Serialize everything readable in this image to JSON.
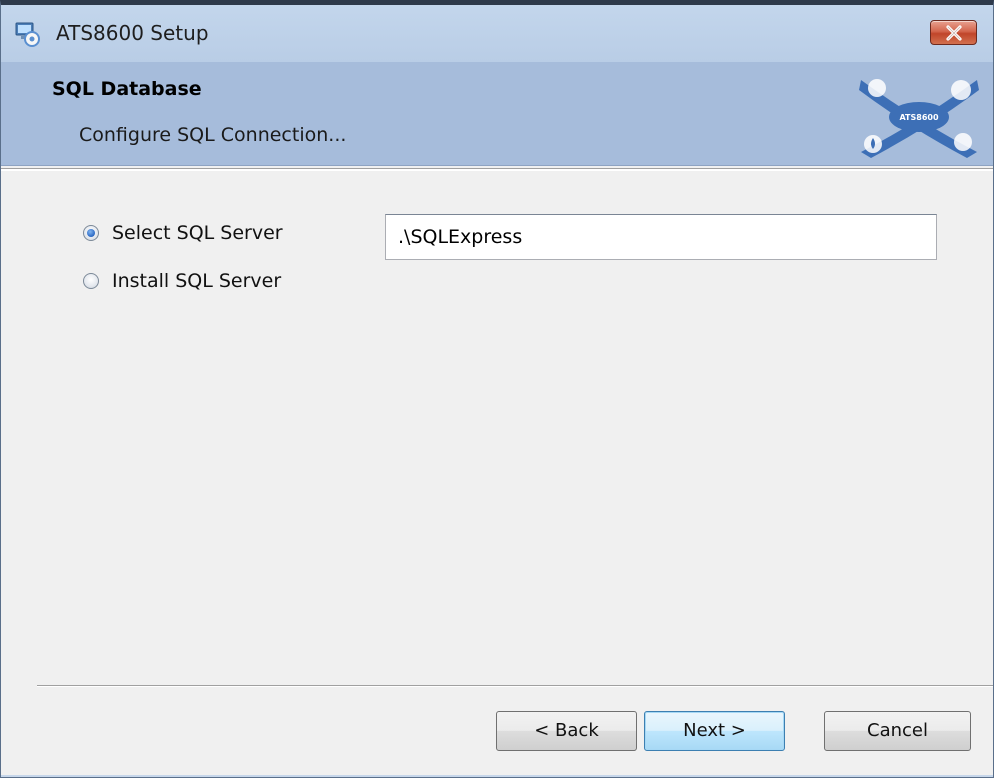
{
  "window": {
    "title": "ATS8600 Setup",
    "app_icon": "setup-computer-icon",
    "close_icon": "close-icon"
  },
  "header": {
    "title": "SQL Database",
    "subtitle": "Configure SQL Connection...",
    "logo_text": "ATS8600",
    "logo_icon": "ats8600-logo"
  },
  "options": {
    "selected": "select",
    "select_label": "Select SQL Server",
    "install_label": "Install SQL Server"
  },
  "server_input": {
    "value": ".\\SQLExpress"
  },
  "buttons": {
    "back": "< Back",
    "next": "Next >",
    "cancel": "Cancel"
  },
  "colors": {
    "header_bg": "#a6bcdb",
    "titlebar_bg": "#c3d6ec",
    "close_button": "#c7472b",
    "dialog_bg": "#f0f0f0"
  }
}
